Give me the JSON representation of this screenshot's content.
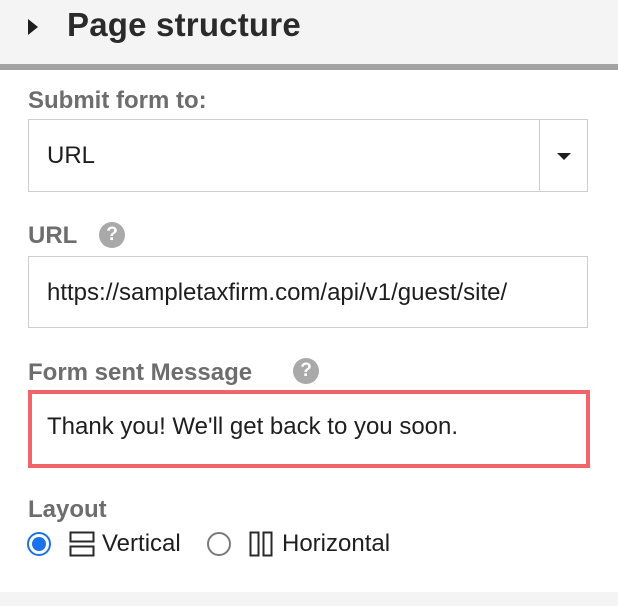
{
  "header": {
    "title": "Page structure"
  },
  "submit_form": {
    "label": "Submit form to:",
    "selected": "URL"
  },
  "url_field": {
    "label": "URL",
    "value": "https://sampletaxfirm.com/api/v1/guest/site/"
  },
  "form_sent_message": {
    "label": "Form sent Message",
    "value": "Thank you! We'll get back to you soon."
  },
  "layout": {
    "label": "Layout",
    "options": [
      {
        "label": "Vertical",
        "checked": true
      },
      {
        "label": "Horizontal",
        "checked": false
      }
    ]
  },
  "help_icon_glyph": "?",
  "colors": {
    "accent": "#1a73e8",
    "highlight_border": "#f0646a",
    "label_text": "#6d6d6d",
    "header_bg": "#f4f4f4"
  }
}
